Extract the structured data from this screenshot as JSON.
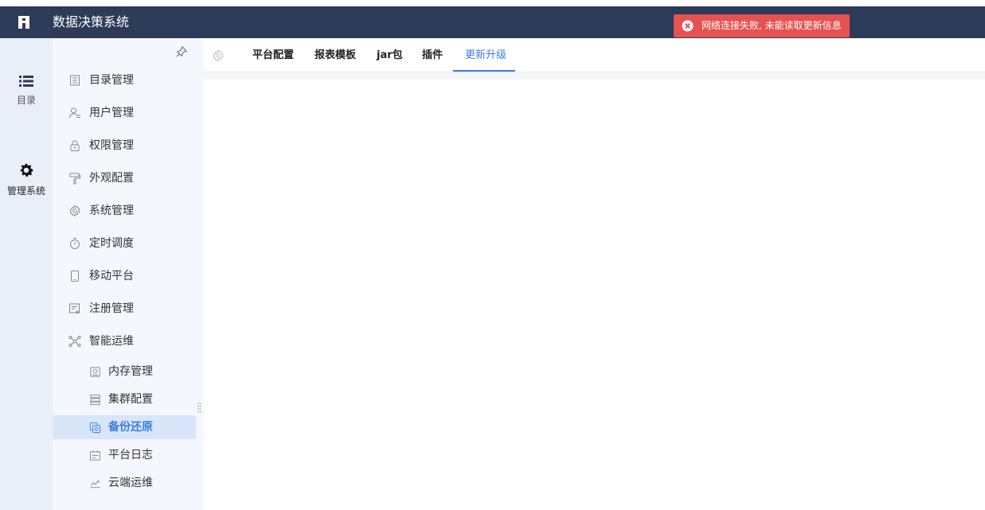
{
  "header": {
    "title": "数据决策系统",
    "logo_icon": "fr-logo-icon",
    "background": "#2c3b57"
  },
  "toast": {
    "message": "网络连接失败, 未能读取更新信息",
    "icon": "error-circle-icon",
    "color": "#e65251"
  },
  "rail": {
    "items": [
      {
        "label": "目录",
        "icon": "list-icon"
      },
      {
        "label": "管理系统",
        "icon": "gear-icon"
      }
    ]
  },
  "menu": {
    "items": [
      {
        "label": "目录管理",
        "icon": "catalog-icon"
      },
      {
        "label": "用户管理",
        "icon": "user-icon"
      },
      {
        "label": "权限管理",
        "icon": "lock-icon"
      },
      {
        "label": "外观配置",
        "icon": "paint-roller-icon"
      },
      {
        "label": "系统管理",
        "icon": "settings-icon"
      },
      {
        "label": "定时调度",
        "icon": "timer-icon"
      },
      {
        "label": "移动平台",
        "icon": "mobile-icon"
      },
      {
        "label": "注册管理",
        "icon": "register-icon"
      },
      {
        "label": "智能运维",
        "icon": "network-icon"
      }
    ],
    "subitems": [
      {
        "label": "内存管理",
        "icon": "memory-icon"
      },
      {
        "label": "集群配置",
        "icon": "cluster-icon"
      },
      {
        "label": "备份还原",
        "icon": "backup-icon",
        "active": true
      },
      {
        "label": "平台日志",
        "icon": "log-icon"
      },
      {
        "label": "云端运维",
        "icon": "cloud-ops-icon"
      }
    ]
  },
  "tabs": {
    "items": [
      "平台配置",
      "报表模板",
      "jar包",
      "插件",
      "更新升级"
    ],
    "active": "更新升级",
    "accent": "#3b7ce0"
  }
}
